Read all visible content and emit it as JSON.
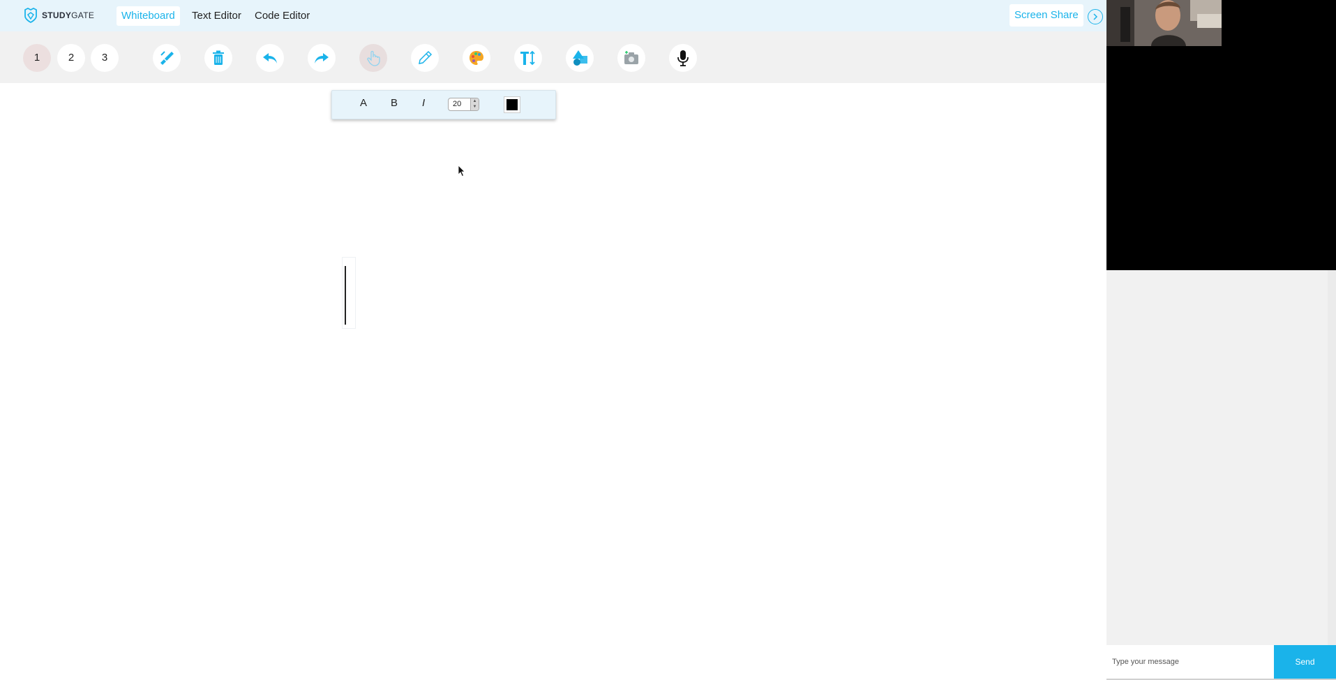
{
  "brand": {
    "name_bold": "STUDY",
    "name_rest": "GATE"
  },
  "nav": {
    "tabs": [
      {
        "label": "Whiteboard"
      },
      {
        "label": "Text Editor"
      },
      {
        "label": "Code Editor"
      }
    ],
    "screen_share": "Screen Share",
    "collapse_icon": "chevron-right-circle-icon"
  },
  "toolbar": {
    "pages": [
      "1",
      "2",
      "3"
    ],
    "active_page": "1",
    "tools": [
      {
        "name": "brush-icon"
      },
      {
        "name": "trash-icon"
      },
      {
        "name": "undo-icon"
      },
      {
        "name": "redo-icon"
      },
      {
        "name": "hand-pointer-icon"
      },
      {
        "name": "pencil-icon"
      },
      {
        "name": "palette-icon"
      },
      {
        "name": "text-tool-icon"
      },
      {
        "name": "shapes-icon"
      },
      {
        "name": "camera-icon"
      },
      {
        "name": "microphone-icon"
      }
    ],
    "active_tool": "hand-pointer-icon"
  },
  "format_bar": {
    "font": "A",
    "bold": "B",
    "italic": "I",
    "size": "20",
    "color": "#000000"
  },
  "chat": {
    "placeholder": "Type your message",
    "send_label": "Send"
  },
  "colors": {
    "accent": "#1ab3ea",
    "nav_bg": "#e7f4fb",
    "toolbar_bg": "#f1f1f1"
  }
}
